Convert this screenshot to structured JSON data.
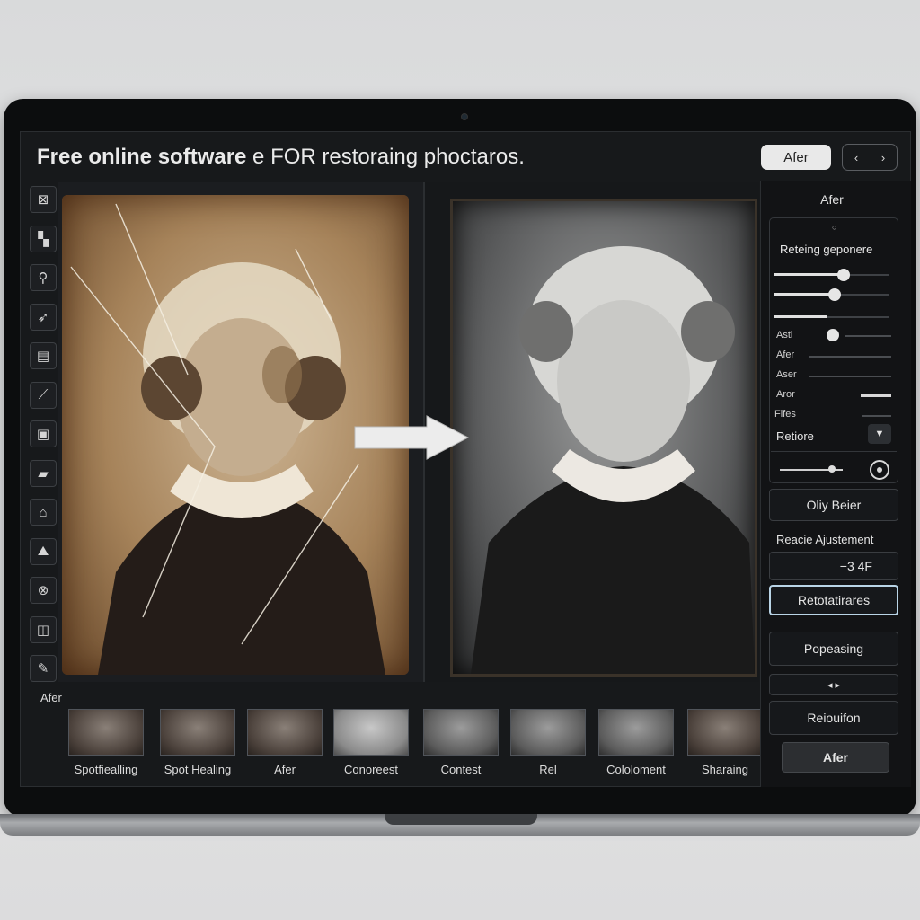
{
  "header": {
    "title_bold": "Free online software",
    "title_rest": " e FOR  restoraing phoctaros.",
    "after_button": "Afer",
    "nav_left": "‹",
    "nav_right": "›"
  },
  "tools": [
    {
      "name": "crop-icon",
      "glyph": "⊠"
    },
    {
      "name": "puzzle-icon",
      "glyph": "▚"
    },
    {
      "name": "magnifier-icon",
      "glyph": "⚲"
    },
    {
      "name": "wand-icon",
      "glyph": "➶"
    },
    {
      "name": "layers-icon",
      "glyph": "▤"
    },
    {
      "name": "brush-icon",
      "glyph": "⟋"
    },
    {
      "name": "image-icon",
      "glyph": "▣"
    },
    {
      "name": "folder-icon",
      "glyph": "▰"
    },
    {
      "name": "stamp-icon",
      "glyph": "⌂"
    },
    {
      "name": "picture-icon",
      "glyph": "⛰"
    },
    {
      "name": "cancel-icon",
      "glyph": "⊗"
    },
    {
      "name": "frame-icon",
      "glyph": "◫"
    },
    {
      "name": "edit-icon",
      "glyph": "✎"
    }
  ],
  "side_panel": {
    "heading": "Afer",
    "small_mark": "○",
    "settings_title": "Reteing geponere",
    "sliders": [
      {
        "label": "",
        "value": 0.6
      },
      {
        "label": "",
        "value": 0.52
      },
      {
        "label": "",
        "value": 0.45
      }
    ],
    "labels": [
      "Asti",
      "Afer",
      "Aser",
      "Aror",
      "Fifes"
    ],
    "restore_label": "Retiore",
    "restore_dropdown": "▼",
    "oliy_button": "Oliy Beier",
    "adjustment_label": "Reacie Ajustement",
    "adjustment_value": "−3 4F",
    "restoration_button": "Retotatirares",
    "popeasing_button": "Popeasing",
    "small_arrows": "◂ ▸",
    "resolution_button": "Reiouifon",
    "after_button": "Afer"
  },
  "filmstrip": {
    "label": "Afer",
    "items": [
      "Spotfiealling",
      "Spot Healing",
      "Afer",
      "Conoreest",
      "Contest",
      "Rel",
      "Cololoment",
      "Sharaing"
    ]
  }
}
